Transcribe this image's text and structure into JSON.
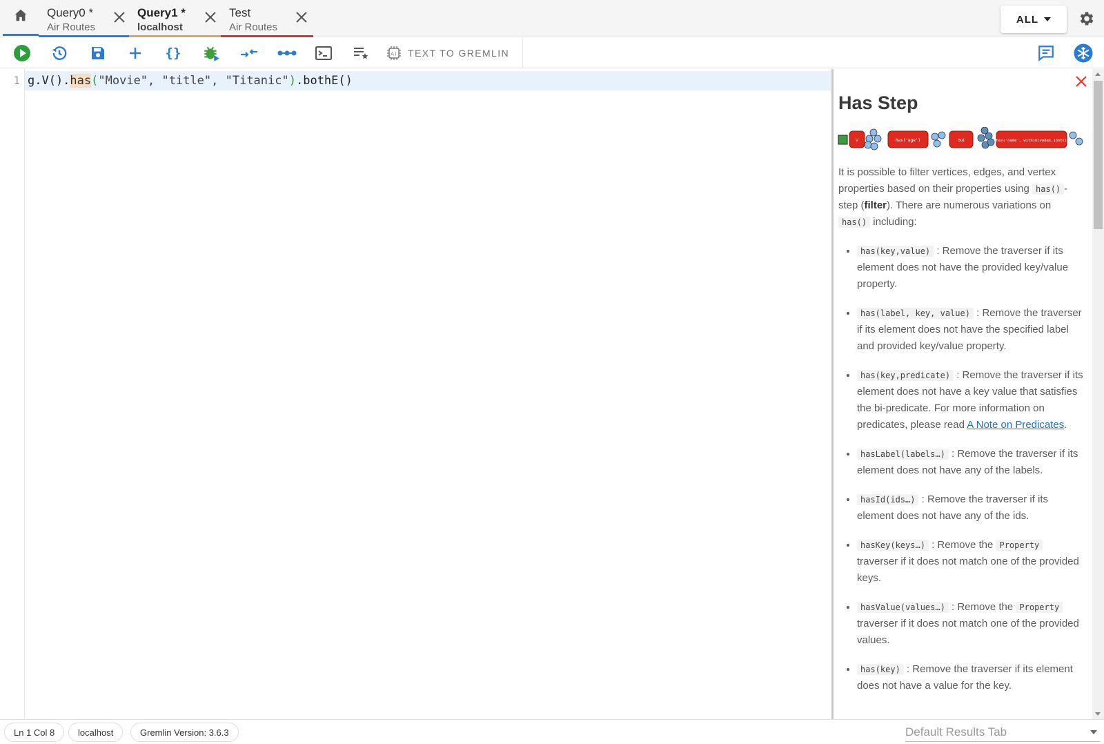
{
  "tabs": [
    {
      "name": "Query0 *",
      "subtitle": "Air Routes",
      "active": false,
      "underline": "#2b7bd3"
    },
    {
      "name": "Query1 *",
      "subtitle": "localhost",
      "active": true,
      "underline": "#c8a875"
    },
    {
      "name": "Test",
      "subtitle": "Air Routes",
      "active": false,
      "underline": "#b04040"
    }
  ],
  "header": {
    "scope_label": "ALL",
    "icons": [
      "home-icon",
      "close-icon",
      "chevron-down-icon",
      "gear-icon"
    ]
  },
  "toolbar": {
    "buttons": [
      "run-icon",
      "history-icon",
      "save-icon",
      "add-icon",
      "format-braces-icon",
      "debug-icon",
      "profile-icon",
      "steps-icon",
      "console-icon",
      "playlist-icon"
    ],
    "text_to_gremlin_label": "TEXT TO GREMLIN",
    "right_icons": [
      "comment-icon",
      "snowflake-icon"
    ],
    "colors": {
      "run": "#2e9e3c",
      "primary": "#2b7bd3",
      "debug": "#3f9f3a"
    }
  },
  "editor": {
    "line_number": "1",
    "code": {
      "prefix": "g.V().",
      "keyword": "has",
      "open_paren": "(",
      "args": "\"Movie\", \"title\", \"Titanic\"",
      "close_paren": ")",
      "suffix": ".bothE()"
    }
  },
  "doc": {
    "title": "Has Step",
    "diagram_labels": [
      "V",
      "has('age')",
      "out",
      "has('name', within(vadas,josh))"
    ],
    "intro": {
      "p1": "It is possible to filter vertices, edges, and vertex properties based on their properties using ",
      "code1": "has()",
      "p2": "-step (",
      "bold": "filter",
      "p3": "). There are numerous variations on ",
      "code2": "has()",
      "p4": " including:"
    },
    "items": [
      {
        "code": "has(key,value)",
        "text": ": Remove the traverser if its element does not have the provided key/value property."
      },
      {
        "code": "has(label, key, value)",
        "text": ": Remove the traverser if its element does not have the specified label and provided key/value property."
      },
      {
        "code": "has(key,predicate)",
        "text": ": Remove the traverser if its element does not have a key value that satisfies the bi-predicate. For more information on predicates, please read ",
        "link": "A Note on Predicates",
        "after": "."
      },
      {
        "code": "hasLabel(labels…)",
        "text": ": Remove the traverser if its element does not have any of the labels."
      },
      {
        "code": "hasId(ids…)",
        "text": ": Remove the traverser if its element does not have any of the ids."
      },
      {
        "code": "hasKey(keys…)",
        "text": ": Remove the ",
        "code2": "Property",
        "text2": " traverser if it does not match one of the provided keys."
      },
      {
        "code": "hasValue(values…)",
        "text": ": Remove the ",
        "code2": "Property",
        "text2": " traverser if it does not match one of the provided values."
      },
      {
        "code": "has(key)",
        "text": ": Remove the traverser if its element does not have a value for the key."
      }
    ],
    "close_color": "#e53935"
  },
  "status": {
    "cursor": "Ln 1 Col 8",
    "host": "localhost",
    "version": "Gremlin Version: 3.6.3",
    "results_tab": "Default Results Tab"
  }
}
